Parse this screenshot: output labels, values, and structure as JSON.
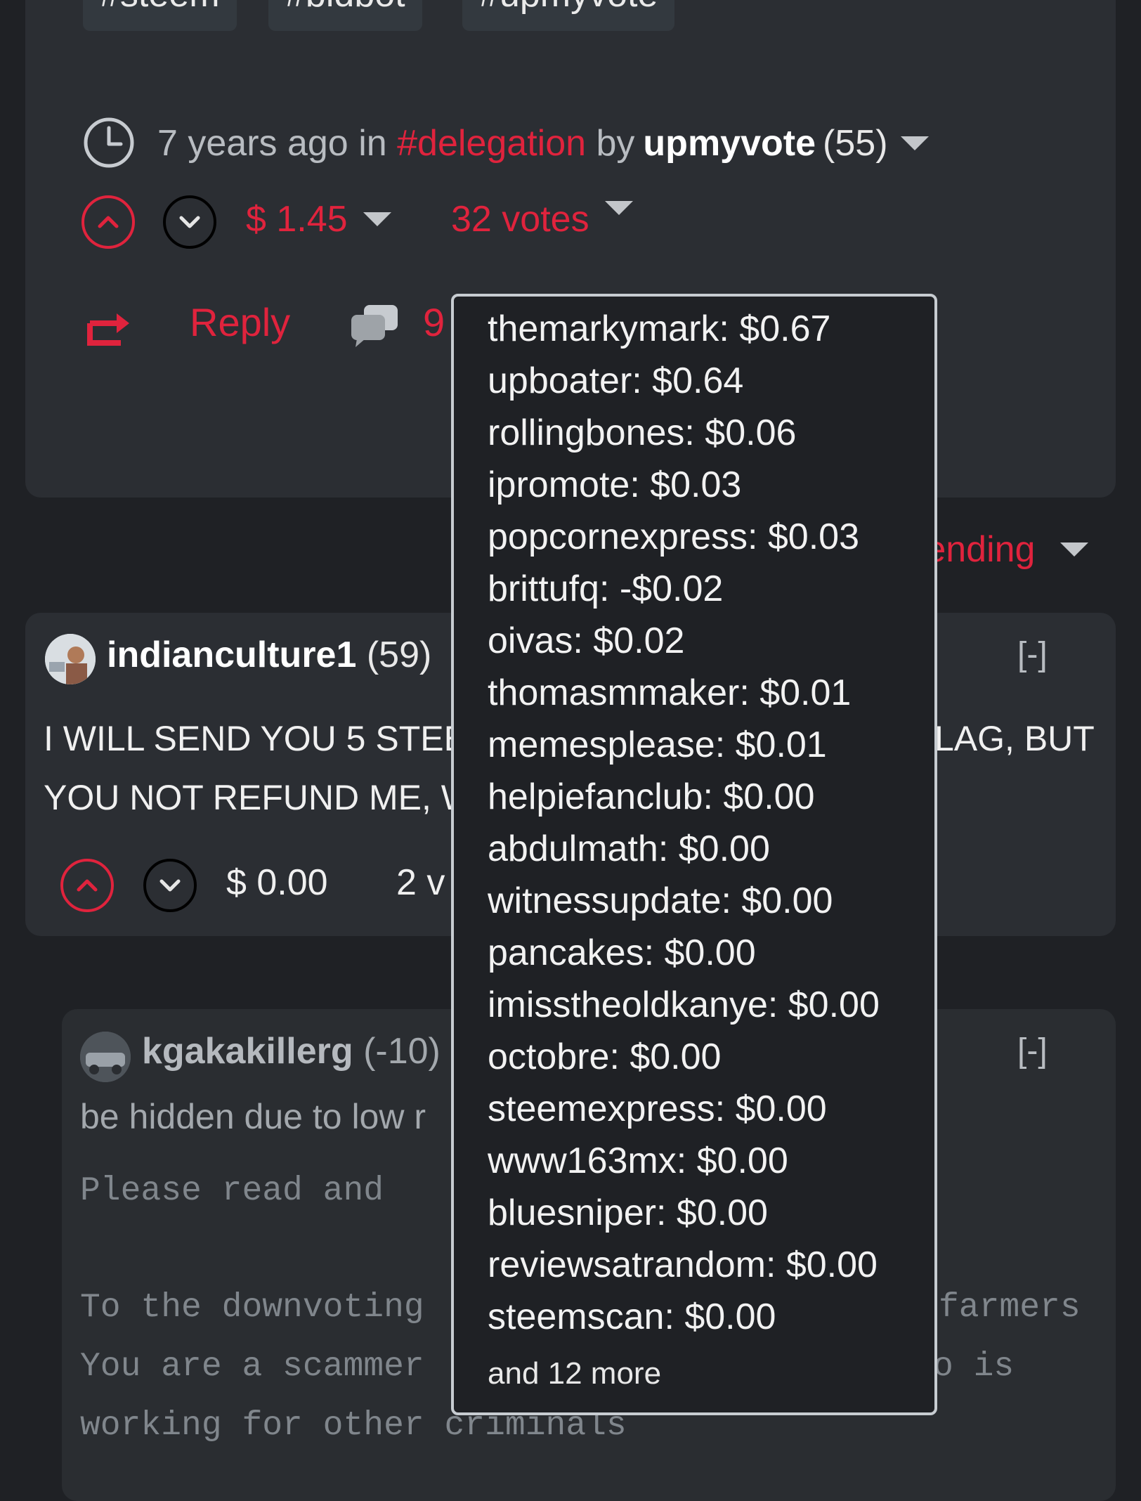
{
  "post": {
    "tags": [
      "#steem",
      "#bidbot",
      "#upmyvote"
    ],
    "time": "7 years ago",
    "in_word": "in",
    "category": "#delegation",
    "by_word": "by",
    "author": "upmyvote",
    "reputation": "(55)",
    "payout": "$ 1.45",
    "votes": "32 votes",
    "reply_label": "Reply",
    "comment_count": "9"
  },
  "sort": {
    "label": "rending"
  },
  "comment1": {
    "author": "indianculture1",
    "reputation": "(59)",
    "collapse": "[-]",
    "line1": "I WILL SEND YOU 5 STEE",
    "line1_tail": "LAG, BUT",
    "line2": "YOU NOT REFUND ME, W",
    "payout": "$ 0.00",
    "votes": "2 v"
  },
  "comment2": {
    "author": "kgakakillerg",
    "reputation": "(-10)",
    "collapse": "[-]",
    "hidden_note": "be hidden due to low r",
    "line_a": "Please read  and",
    "line_b": "To the downvoting",
    "line_b_tail": "farmers",
    "line_c": "You are a scammer",
    "line_c_tail": "o is",
    "line_d": "working for other criminals"
  },
  "voters": [
    "themarkymark: $0.67",
    "upboater: $0.64",
    "rollingbones: $0.06",
    "ipromote: $0.03",
    "popcornexpress: $0.03",
    "brittufq: -$0.02",
    "oivas: $0.02",
    "thomasmmaker: $0.01",
    "memesplease: $0.01",
    "helpiefanclub: $0.00",
    "abdulmath: $0.00",
    "witnessupdate: $0.00",
    "pancakes: $0.00",
    "imisstheoldkanye: $0.00",
    "octobre: $0.00",
    "steemexpress: $0.00",
    "www163mx: $0.00",
    "bluesniper: $0.00",
    "reviewsatrandom: $0.00",
    "steemscan: $0.00"
  ],
  "voters_more": "and 12 more",
  "colors": {
    "accent": "#e0233d",
    "background": "#1f2125",
    "card": "#2b2e33"
  },
  "icons": [
    "clock-icon",
    "upvote-icon",
    "downvote-icon",
    "caret-down-icon",
    "reblog-icon",
    "comments-icon"
  ]
}
